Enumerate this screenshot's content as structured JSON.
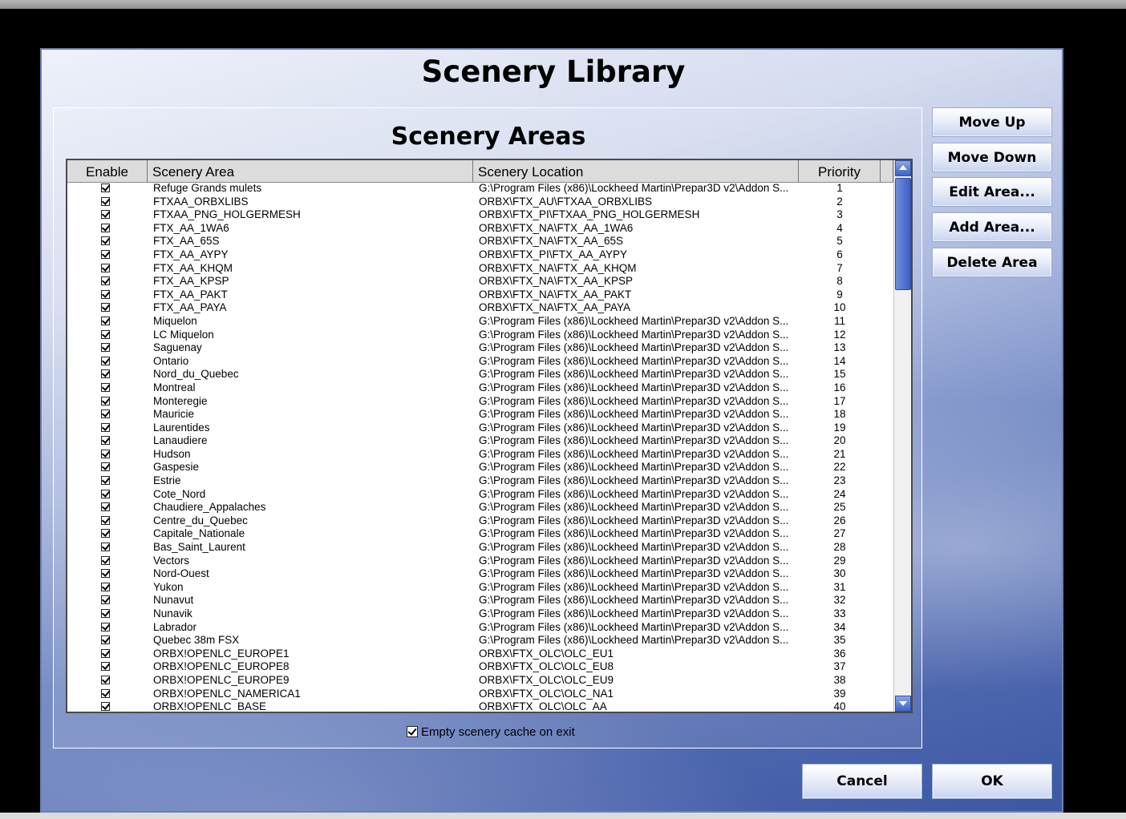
{
  "dialog": {
    "title": "Scenery Library"
  },
  "areas": {
    "title": "Scenery Areas",
    "columns": {
      "enable": "Enable",
      "area": "Scenery Area",
      "location": "Scenery Location",
      "priority": "Priority"
    },
    "rows": [
      {
        "area": "Refuge Grands mulets",
        "location": "G:\\Program Files (x86)\\Lockheed Martin\\Prepar3D v2\\Addon S...",
        "priority": "1"
      },
      {
        "area": "FTXAA_ORBXLIBS",
        "location": "ORBX\\FTX_AU\\FTXAA_ORBXLIBS",
        "priority": "2"
      },
      {
        "area": "FTXAA_PNG_HOLGERMESH",
        "location": "ORBX\\FTX_PI\\FTXAA_PNG_HOLGERMESH",
        "priority": "3"
      },
      {
        "area": "FTX_AA_1WA6",
        "location": "ORBX\\FTX_NA\\FTX_AA_1WA6",
        "priority": "4"
      },
      {
        "area": "FTX_AA_65S",
        "location": "ORBX\\FTX_NA\\FTX_AA_65S",
        "priority": "5"
      },
      {
        "area": "FTX_AA_AYPY",
        "location": "ORBX\\FTX_PI\\FTX_AA_AYPY",
        "priority": "6"
      },
      {
        "area": "FTX_AA_KHQM",
        "location": "ORBX\\FTX_NA\\FTX_AA_KHQM",
        "priority": "7"
      },
      {
        "area": "FTX_AA_KPSP",
        "location": "ORBX\\FTX_NA\\FTX_AA_KPSP",
        "priority": "8"
      },
      {
        "area": "FTX_AA_PAKT",
        "location": "ORBX\\FTX_NA\\FTX_AA_PAKT",
        "priority": "9"
      },
      {
        "area": "FTX_AA_PAYA",
        "location": "ORBX\\FTX_NA\\FTX_AA_PAYA",
        "priority": "10"
      },
      {
        "area": "Miquelon",
        "location": "G:\\Program Files (x86)\\Lockheed Martin\\Prepar3D v2\\Addon S...",
        "priority": "11"
      },
      {
        "area": "LC Miquelon",
        "location": "G:\\Program Files (x86)\\Lockheed Martin\\Prepar3D v2\\Addon S...",
        "priority": "12"
      },
      {
        "area": "Saguenay",
        "location": "G:\\Program Files (x86)\\Lockheed Martin\\Prepar3D v2\\Addon S...",
        "priority": "13"
      },
      {
        "area": "Ontario",
        "location": "G:\\Program Files (x86)\\Lockheed Martin\\Prepar3D v2\\Addon S...",
        "priority": "14"
      },
      {
        "area": "Nord_du_Quebec",
        "location": "G:\\Program Files (x86)\\Lockheed Martin\\Prepar3D v2\\Addon S...",
        "priority": "15"
      },
      {
        "area": "Montreal",
        "location": "G:\\Program Files (x86)\\Lockheed Martin\\Prepar3D v2\\Addon S...",
        "priority": "16"
      },
      {
        "area": "Monteregie",
        "location": "G:\\Program Files (x86)\\Lockheed Martin\\Prepar3D v2\\Addon S...",
        "priority": "17"
      },
      {
        "area": "Mauricie",
        "location": "G:\\Program Files (x86)\\Lockheed Martin\\Prepar3D v2\\Addon S...",
        "priority": "18"
      },
      {
        "area": "Laurentides",
        "location": "G:\\Program Files (x86)\\Lockheed Martin\\Prepar3D v2\\Addon S...",
        "priority": "19"
      },
      {
        "area": "Lanaudiere",
        "location": "G:\\Program Files (x86)\\Lockheed Martin\\Prepar3D v2\\Addon S...",
        "priority": "20"
      },
      {
        "area": "Hudson",
        "location": "G:\\Program Files (x86)\\Lockheed Martin\\Prepar3D v2\\Addon S...",
        "priority": "21"
      },
      {
        "area": "Gaspesie",
        "location": "G:\\Program Files (x86)\\Lockheed Martin\\Prepar3D v2\\Addon S...",
        "priority": "22"
      },
      {
        "area": "Estrie",
        "location": "G:\\Program Files (x86)\\Lockheed Martin\\Prepar3D v2\\Addon S...",
        "priority": "23"
      },
      {
        "area": "Cote_Nord",
        "location": "G:\\Program Files (x86)\\Lockheed Martin\\Prepar3D v2\\Addon S...",
        "priority": "24"
      },
      {
        "area": "Chaudiere_Appalaches",
        "location": "G:\\Program Files (x86)\\Lockheed Martin\\Prepar3D v2\\Addon S...",
        "priority": "25"
      },
      {
        "area": "Centre_du_Quebec",
        "location": "G:\\Program Files (x86)\\Lockheed Martin\\Prepar3D v2\\Addon S...",
        "priority": "26"
      },
      {
        "area": "Capitale_Nationale",
        "location": "G:\\Program Files (x86)\\Lockheed Martin\\Prepar3D v2\\Addon S...",
        "priority": "27"
      },
      {
        "area": "Bas_Saint_Laurent",
        "location": "G:\\Program Files (x86)\\Lockheed Martin\\Prepar3D v2\\Addon S...",
        "priority": "28"
      },
      {
        "area": "Vectors",
        "location": "G:\\Program Files (x86)\\Lockheed Martin\\Prepar3D v2\\Addon S...",
        "priority": "29"
      },
      {
        "area": "Nord-Ouest",
        "location": "G:\\Program Files (x86)\\Lockheed Martin\\Prepar3D v2\\Addon S...",
        "priority": "30"
      },
      {
        "area": "Yukon",
        "location": "G:\\Program Files (x86)\\Lockheed Martin\\Prepar3D v2\\Addon S...",
        "priority": "31"
      },
      {
        "area": "Nunavut",
        "location": "G:\\Program Files (x86)\\Lockheed Martin\\Prepar3D v2\\Addon S...",
        "priority": "32"
      },
      {
        "area": "Nunavik",
        "location": "G:\\Program Files (x86)\\Lockheed Martin\\Prepar3D v2\\Addon S...",
        "priority": "33"
      },
      {
        "area": "Labrador",
        "location": "G:\\Program Files (x86)\\Lockheed Martin\\Prepar3D v2\\Addon S...",
        "priority": "34"
      },
      {
        "area": "Quebec 38m FSX",
        "location": "G:\\Program Files (x86)\\Lockheed Martin\\Prepar3D v2\\Addon S...",
        "priority": "35"
      },
      {
        "area": "ORBX!OPENLC_EUROPE1",
        "location": "ORBX\\FTX_OLC\\OLC_EU1",
        "priority": "36"
      },
      {
        "area": "ORBX!OPENLC_EUROPE8",
        "location": "ORBX\\FTX_OLC\\OLC_EU8",
        "priority": "37"
      },
      {
        "area": "ORBX!OPENLC_EUROPE9",
        "location": "ORBX\\FTX_OLC\\OLC_EU9",
        "priority": "38"
      },
      {
        "area": "ORBX!OPENLC_NAMERICA1",
        "location": "ORBX\\FTX_OLC\\OLC_NA1",
        "priority": "39"
      },
      {
        "area": "ORBX!OPENLC_BASE",
        "location": "ORBX\\FTX_OLC\\OLC_AA",
        "priority": "40"
      }
    ]
  },
  "cache": {
    "label": "Empty scenery cache on exit",
    "checked": true
  },
  "buttons": {
    "move_up": "Move Up",
    "move_down": "Move Down",
    "edit_area": "Edit Area...",
    "add_area": "Add Area...",
    "delete_area": "Delete Area",
    "cancel": "Cancel",
    "ok": "OK"
  },
  "colors": {
    "accent": "#3d58a3",
    "window_frame": "#6c7fae"
  }
}
